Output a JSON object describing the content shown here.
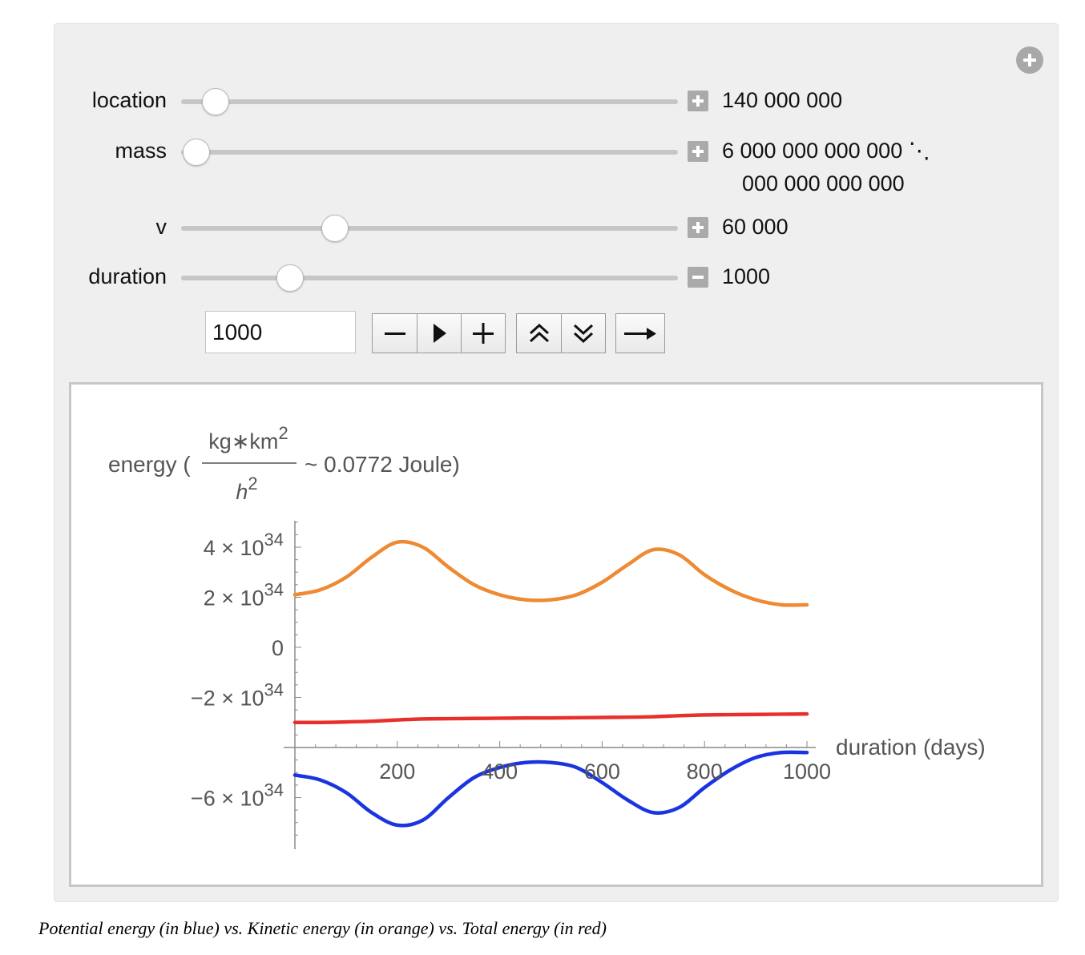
{
  "controls": {
    "sliders": [
      {
        "key": "location",
        "label": "location",
        "value_lines": [
          "140 000 000"
        ],
        "position": 0.07,
        "toggle": "plus"
      },
      {
        "key": "mass",
        "label": "mass",
        "value_lines": [
          "6 000 000 000 000 ⋱",
          "000 000 000 000"
        ],
        "position": 0.03,
        "toggle": "plus"
      },
      {
        "key": "v",
        "label": "v",
        "value_lines": [
          "60 000"
        ],
        "position": 0.31,
        "toggle": "plus"
      },
      {
        "key": "duration",
        "label": "duration",
        "value_lines": [
          "1000"
        ],
        "position": 0.22,
        "toggle": "minus"
      }
    ],
    "animator": {
      "input_value": "1000",
      "buttons": [
        "step-back",
        "play",
        "step-forward",
        "faster",
        "slower",
        "direction"
      ]
    }
  },
  "chart_data": {
    "type": "line",
    "ylabel": {
      "prefix": "energy (",
      "fraction_numerator": "kg∗km",
      "numerator_exponent": "2",
      "fraction_denominator": "h",
      "denominator_exponent": "2",
      "suffix": "~ 0.0772 Joule)"
    },
    "xlabel": "duration (days)",
    "xlim": [
      0,
      1000
    ],
    "ylim": [
      -7.5e+34,
      5e+34
    ],
    "x_ticks": [
      {
        "value": 200,
        "label": "200"
      },
      {
        "value": 400,
        "label": "400"
      },
      {
        "value": 600,
        "label": "600"
      },
      {
        "value": 800,
        "label": "800"
      },
      {
        "value": 1000,
        "label": "1000"
      }
    ],
    "y_ticks": [
      {
        "value": 4e+34,
        "mantissa": "4 × 10",
        "exponent": "34"
      },
      {
        "value": 2e+34,
        "mantissa": "2 × 10",
        "exponent": "34"
      },
      {
        "value": 0,
        "mantissa": "0",
        "exponent": ""
      },
      {
        "value": -2e+34,
        "mantissa": "−2 × 10",
        "exponent": "34"
      },
      {
        "value": -6e+34,
        "mantissa": "−6 × 10",
        "exponent": "34"
      }
    ],
    "x_axis_at_y": -4e+34,
    "x": [
      0,
      50,
      100,
      150,
      200,
      250,
      300,
      350,
      400,
      450,
      500,
      550,
      600,
      650,
      700,
      750,
      800,
      850,
      900,
      950,
      1000
    ],
    "series": [
      {
        "color": "#ee8a34",
        "values": [
          2.1,
          2.3,
          2.8,
          3.6,
          4.2,
          4.0,
          3.2,
          2.5,
          2.1,
          1.9,
          1.9,
          2.1,
          2.6,
          3.3,
          3.9,
          3.7,
          2.9,
          2.3,
          1.9,
          1.7,
          1.7
        ]
      },
      {
        "color": "#e8302a",
        "values": [
          -3.0,
          -3.0,
          -2.98,
          -2.95,
          -2.9,
          -2.86,
          -2.85,
          -2.84,
          -2.83,
          -2.82,
          -2.82,
          -2.81,
          -2.8,
          -2.79,
          -2.77,
          -2.73,
          -2.7,
          -2.69,
          -2.68,
          -2.67,
          -2.66
        ]
      },
      {
        "color": "#1a34e0",
        "values": [
          -5.1,
          -5.3,
          -5.8,
          -6.6,
          -7.1,
          -6.9,
          -6.0,
          -5.2,
          -4.8,
          -4.6,
          -4.6,
          -4.8,
          -5.4,
          -6.1,
          -6.6,
          -6.4,
          -5.6,
          -4.9,
          -4.4,
          -4.2,
          -4.2
        ]
      }
    ]
  },
  "caption": "Potential energy (in blue) vs. Kinetic energy (in orange) vs. Total energy (in red)"
}
